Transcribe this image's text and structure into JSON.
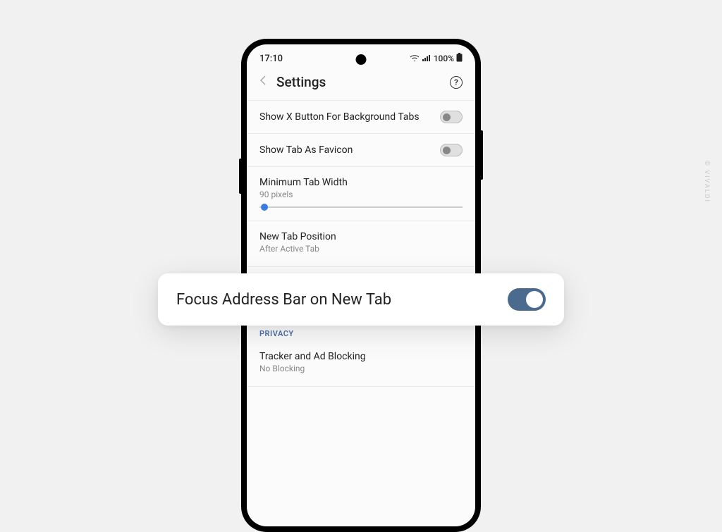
{
  "status": {
    "time": "17:10",
    "battery": "100%"
  },
  "header": {
    "title": "Settings"
  },
  "settings": {
    "row0": {
      "label": "Show X Button For Background Tabs"
    },
    "row1": {
      "label": "Show Tab As Favicon"
    },
    "row2": {
      "label": "Minimum Tab Width",
      "value": "90 pixels"
    },
    "row3": {
      "label": "New Tab Position",
      "value": "After Active Tab"
    }
  },
  "popout": {
    "label": "Focus Address Bar on New Tab"
  },
  "privacy": {
    "header": "PRIVACY",
    "row0": {
      "label": "Tracker and Ad Blocking",
      "value": "No Blocking"
    }
  },
  "watermark": "© VIVALDI"
}
